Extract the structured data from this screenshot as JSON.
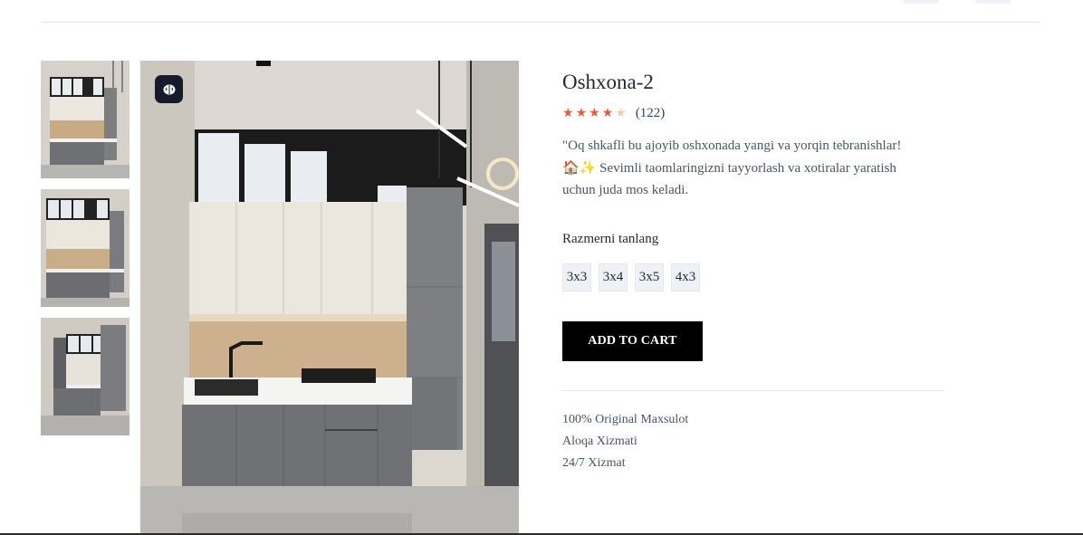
{
  "product": {
    "title": "Oshxona-2",
    "rating": 4,
    "rating_max": 5,
    "review_count": "(122)",
    "description_line1": "\"Oq shkafli bu ajoyib oshxonada yangi va yorqin tebranishlar!",
    "description_emoji": "🏠✨",
    "description_line2": " Sevimli taomlaringizni tayyorlash va xotiralar yaratish",
    "description_line3": "uchun juda mos keladi.",
    "size_label": "Razmerni tanlang",
    "sizes": [
      "3x3",
      "3x4",
      "3x5",
      "4x3"
    ],
    "add_to_cart": "ADD TO CART",
    "features": [
      "100% Original Maxsulot",
      "Aloqa Xizmati",
      "24/7 Xizmat"
    ]
  },
  "gallery": {
    "thumbnail_count": 3,
    "zoom_icon": "brain-icon"
  },
  "colors": {
    "star_active": "#f0563a",
    "star_inactive": "#f7c8bc",
    "cart_button": "#000000",
    "size_button_bg": "#eef2f6"
  }
}
